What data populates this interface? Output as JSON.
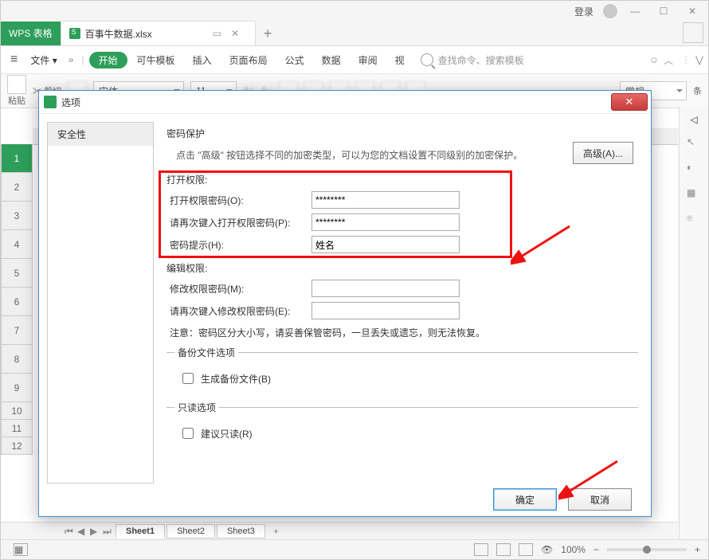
{
  "titlebar": {
    "login": "登录"
  },
  "tabs": {
    "app": "WPS 表格",
    "doc": "百事牛数据.xlsx",
    "new": "+"
  },
  "menubar": {
    "file": "文件",
    "start": "开始",
    "template": "可牛模板",
    "insert": "插入",
    "layout": "页面布局",
    "formula": "公式",
    "data": "数据",
    "review": "审阅",
    "view": "视",
    "search_placeholder": "查找命令、搜索模板",
    "chev": "»"
  },
  "ribbon": {
    "paste": "粘贴",
    "cut": "剪切",
    "font": "宋体",
    "size": "11",
    "style": "常规",
    "cond": "条"
  },
  "rows": [
    "1",
    "2",
    "3",
    "4",
    "5",
    "6",
    "7",
    "8",
    "9",
    "10",
    "11",
    "12"
  ],
  "sheets": {
    "s1": "Sheet1",
    "s2": "Sheet2",
    "s3": "Sheet3",
    "add": "+"
  },
  "status": {
    "zoom": "100%"
  },
  "dialog": {
    "title": "选项",
    "nav_security": "安全性",
    "pw_section": "密码保护",
    "pw_hint": "点击 \"高级\" 按钮选择不同的加密类型，可以为您的文档设置不同级别的加密保护。",
    "advanced": "高级(A)...",
    "open_perm_legend": "打开权限:",
    "open_pw_label": "打开权限密码(O):",
    "open_pw_value": "********",
    "open_pw2_label": "请再次键入打开权限密码(P):",
    "open_pw2_value": "********",
    "hint_label": "密码提示(H):",
    "hint_value": "姓名",
    "edit_perm_legend": "编辑权限:",
    "edit_pw_label": "修改权限密码(M):",
    "edit_pw2_label": "请再次键入修改权限密码(E):",
    "note": "注意：密码区分大小写，请妥善保管密码，一旦丢失或遗忘，则无法恢复。",
    "backup_legend": "备份文件选项",
    "backup_chk": "生成备份文件(B)",
    "readonly_legend": "只读选项",
    "readonly_chk": "建议只读(R)",
    "ok": "确定",
    "cancel": "取消"
  }
}
